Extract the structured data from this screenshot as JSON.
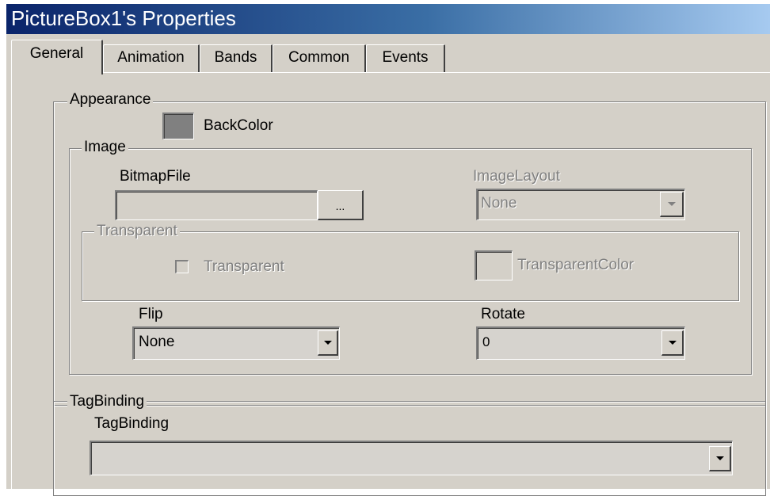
{
  "window": {
    "title": "PictureBox1's Properties"
  },
  "tabs": [
    {
      "label": "General",
      "active": true
    },
    {
      "label": "Animation",
      "active": false
    },
    {
      "label": "Bands",
      "active": false
    },
    {
      "label": "Common",
      "active": false
    },
    {
      "label": "Events",
      "active": false
    }
  ],
  "appearance": {
    "legend": "Appearance",
    "backcolor_label": "BackColor",
    "backcolor_value": "#808080"
  },
  "image": {
    "legend": "Image",
    "bitmapfile_label": "BitmapFile",
    "bitmapfile_value": "",
    "browse_label": "...",
    "imagelayout_label": "ImageLayout",
    "imagelayout_value": "None",
    "transparent": {
      "legend": "Transparent",
      "checkbox_label": "Transparent",
      "checked": false,
      "color_label": "TransparentColor"
    },
    "flip_label": "Flip",
    "flip_value": "None",
    "rotate_label": "Rotate",
    "rotate_value": "0"
  },
  "tagbinding": {
    "legend": "TagBinding",
    "label": "TagBinding",
    "value": ""
  }
}
